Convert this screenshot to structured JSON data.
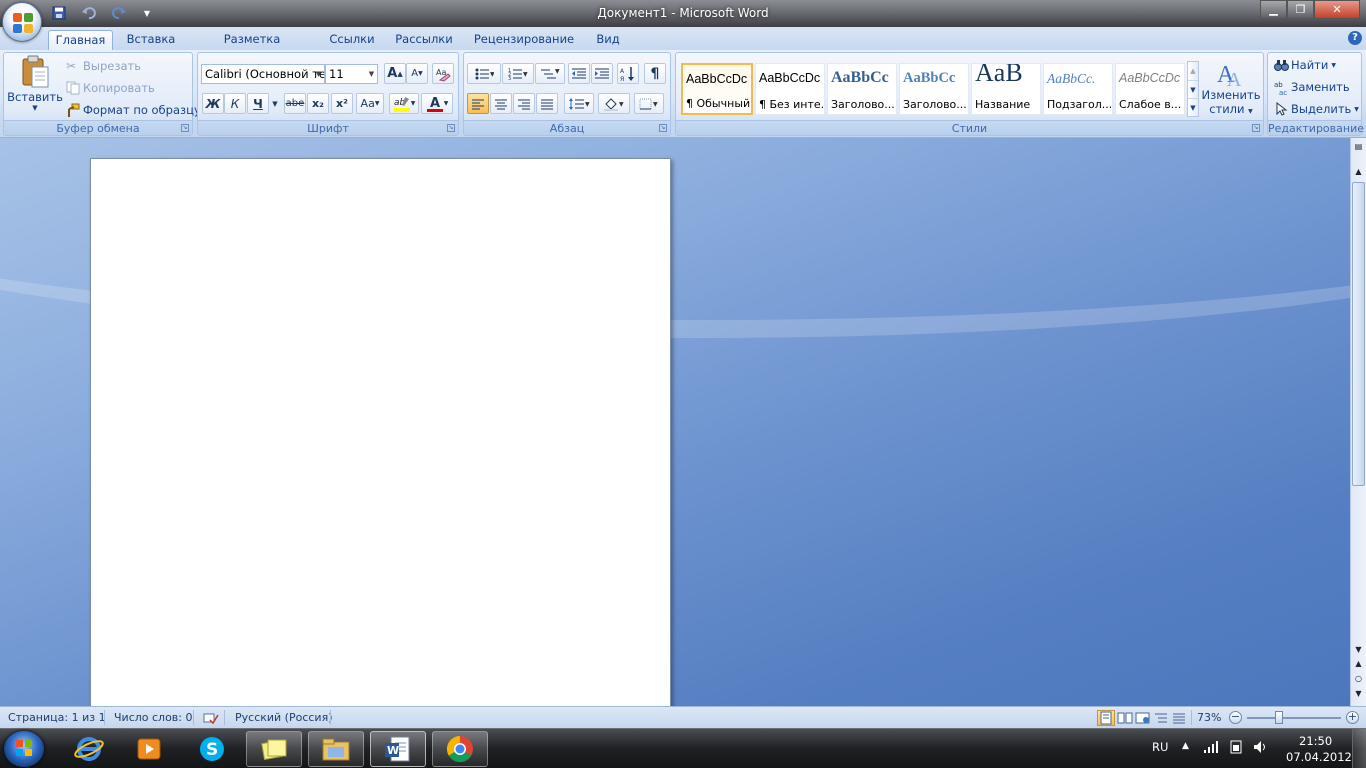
{
  "window": {
    "title": "Документ1 - Microsoft Word",
    "minimize_glyph": "▁",
    "maximize_glyph": "❐",
    "close_glyph": "✕"
  },
  "quick_access": {
    "save_icon": "save-icon",
    "undo_icon": "undo-icon",
    "redo_icon": "redo-icon",
    "customize_icon": "customize-dropdown-icon"
  },
  "tabs": [
    {
      "label": "Главная",
      "active": true
    },
    {
      "label": "Вставка"
    },
    {
      "label": "Разметка страницы"
    },
    {
      "label": "Ссылки"
    },
    {
      "label": "Рассылки"
    },
    {
      "label": "Рецензирование"
    },
    {
      "label": "Вид"
    }
  ],
  "help_glyph": "?",
  "clipboard": {
    "group_label": "Буфер обмена",
    "paste_label": "Вставить",
    "cut_label": "Вырезать",
    "copy_label": "Копировать",
    "format_painter_label": "Формат по образцу"
  },
  "font": {
    "group_label": "Шрифт",
    "font_name": "Calibri (Основной те",
    "font_size": "11",
    "grow_label": "A",
    "shrink_label": "A",
    "bold": "Ж",
    "italic": "К",
    "underline": "Ч",
    "strike": "abe",
    "subscript": "x₂",
    "superscript": "x²",
    "change_case": "Aa",
    "highlight_text": "ab",
    "font_color_text": "A",
    "highlight_color": "#ffff00",
    "font_color": "#e00000"
  },
  "paragraph": {
    "group_label": "Абзац",
    "show_marks": "¶"
  },
  "styles": {
    "group_label": "Стили",
    "items": [
      {
        "sample": "AaBbCcDc",
        "name": "¶ Обычный",
        "selected": true
      },
      {
        "sample": "AaBbCcDc",
        "name": "¶ Без инте..."
      },
      {
        "sample": "AaBbCc",
        "name": "Заголово..."
      },
      {
        "sample": "AaBbCc",
        "name": "Заголово..."
      },
      {
        "sample": "AaB",
        "name": "Название"
      },
      {
        "sample": "AaBbCc.",
        "name": "Подзагол..."
      },
      {
        "sample": "AaBbCcDc",
        "name": "Слабое в..."
      }
    ],
    "change_styles_label_1": "Изменить",
    "change_styles_label_2": "стили"
  },
  "editing": {
    "group_label": "Редактирование",
    "find_label": "Найти",
    "replace_label": "Заменить",
    "select_label": "Выделить"
  },
  "status": {
    "page": "Страница: 1 из 1",
    "words": "Число слов: 0",
    "language": "Русский (Россия)",
    "zoom": "73%",
    "zoom_level": 0.73
  },
  "taskbar": {
    "lang": "RU",
    "time": "21:50",
    "date": "07.04.2012"
  },
  "colors": {
    "accent": "#15428b",
    "selected_style_border": "#f5b94d"
  }
}
